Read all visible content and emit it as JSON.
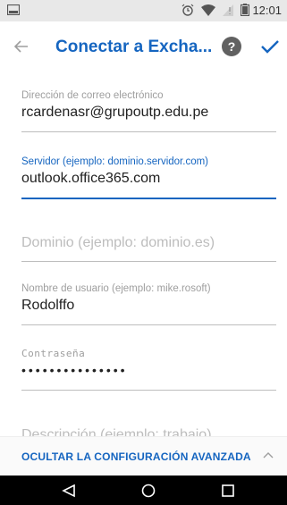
{
  "status_bar": {
    "time": "12:01",
    "icons": [
      "screen-icon",
      "alarm-icon",
      "wifi-icon",
      "no-signal-icon",
      "battery-icon"
    ]
  },
  "app_bar": {
    "title": "Conectar a Excha...",
    "help_label": "?",
    "back_icon": "back-arrow-icon",
    "confirm_icon": "check-icon"
  },
  "form": {
    "email": {
      "label": "Dirección de correo electrónico",
      "value": "rcardenasr@grupoutp.edu.pe"
    },
    "server": {
      "label": "Servidor (ejemplo: dominio.servidor.com)",
      "value": "outlook.office365.com"
    },
    "domain": {
      "placeholder": "Dominio (ejemplo: dominio.es)"
    },
    "username": {
      "label": "Nombre de usuario (ejemplo: mike.rosoft)",
      "value": "Rodolffo"
    },
    "password": {
      "label": "Contraseña",
      "value": "•••••••••••••••"
    },
    "description": {
      "placeholder": "Descripción (ejemplo: trabajo)"
    }
  },
  "advanced": {
    "label": "OCULTAR LA CONFIGURACIÓN AVANZADA"
  },
  "colors": {
    "accent": "#1565c0",
    "status_bar_bg": "#e8e8e8",
    "nav_bar_bg": "#000000"
  }
}
